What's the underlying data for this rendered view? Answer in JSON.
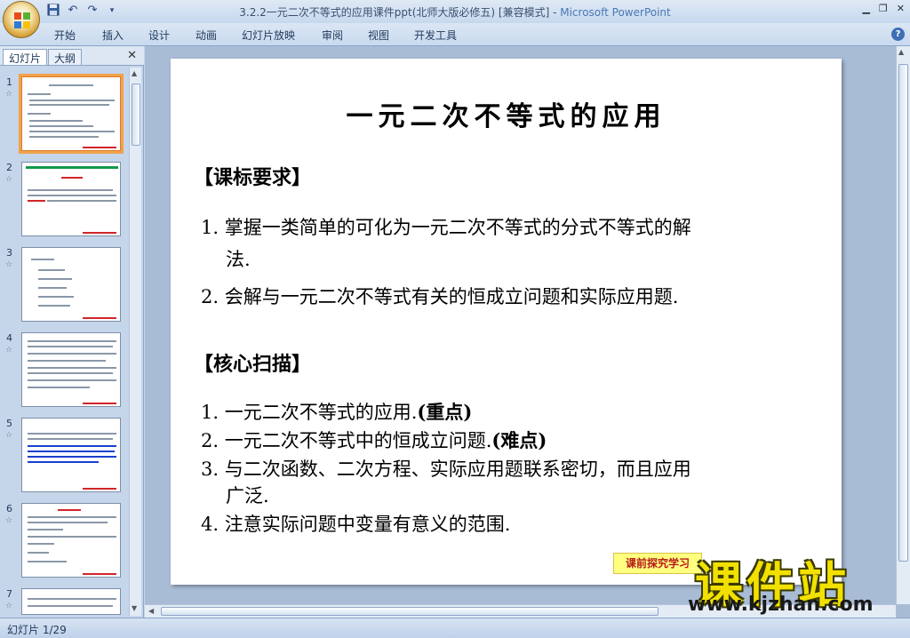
{
  "window": {
    "title_prefix": "3.2.2一元二次不等式的应用课件ppt(北师大版必修五) [兼容模式] - ",
    "title_app": "Microsoft PowerPoint"
  },
  "ribbon_tabs": [
    "开始",
    "插入",
    "设计",
    "动画",
    "幻灯片放映",
    "审阅",
    "视图",
    "开发工具"
  ],
  "pane": {
    "tab_slides": "幻灯片",
    "tab_outline": "大纲",
    "thumbs": [
      "1",
      "2",
      "3",
      "4",
      "5",
      "6",
      "7"
    ],
    "star": "☆"
  },
  "slide": {
    "title": "一元二次不等式的应用",
    "section1": "【课标要求】",
    "req1_a": "1. 掌握一类简单的可化为一元二次不等式的分式不等式的解",
    "req1_b": "法.",
    "req2": "2. 会解与一元二次不等式有关的恒成立问题和实际应用题.",
    "section2": "【核心扫描】",
    "core1": "1. 一元二次不等式的应用.",
    "core1_tag": "(重点)",
    "core2": "2. 一元二次不等式中的恒成立问题.",
    "core2_tag": "(难点)",
    "core3_a": "3. 与二次函数、二次方程、实际应用题联系密切，而且应用",
    "core3_b": "广泛.",
    "core4": "4. 注意实际问题中变量有意义的范围.",
    "banner": "课前探究学习"
  },
  "status": {
    "text": "幻灯片 1/29"
  },
  "watermark": {
    "main": "课件站",
    "url": "www.kjzhan.com"
  }
}
